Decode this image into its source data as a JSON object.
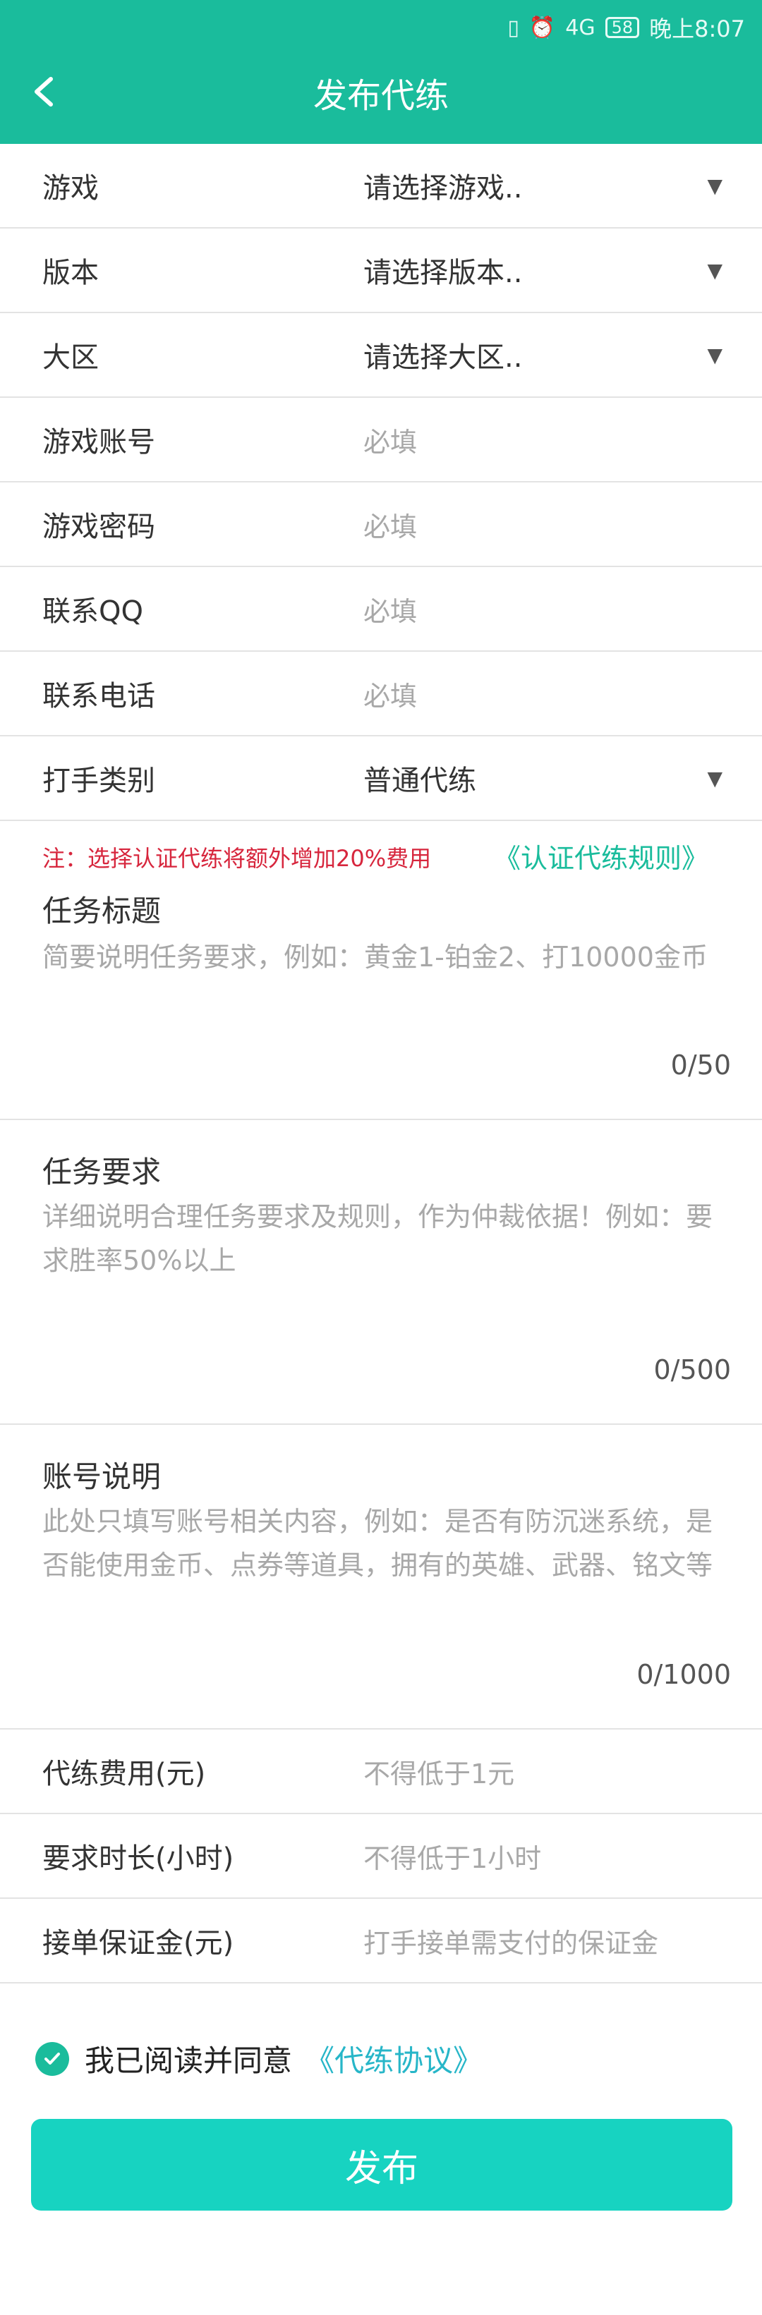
{
  "status_bar": {
    "signal": "4G",
    "battery": "58",
    "time": "晚上8:07"
  },
  "header": {
    "title": "发布代练"
  },
  "fields": [
    {
      "label": "游戏",
      "value": "请选择游戏..",
      "type": "select"
    },
    {
      "label": "版本",
      "value": "请选择版本..",
      "type": "select"
    },
    {
      "label": "大区",
      "value": "请选择大区..",
      "type": "select"
    },
    {
      "label": "游戏账号",
      "placeholder": "必填",
      "type": "input"
    },
    {
      "label": "游戏密码",
      "placeholder": "必填",
      "type": "input"
    },
    {
      "label": "联系QQ",
      "placeholder": "必填",
      "type": "input"
    },
    {
      "label": "联系电话",
      "placeholder": "必填",
      "type": "input"
    },
    {
      "label": "打手类别",
      "value": "普通代练",
      "type": "select"
    }
  ],
  "note": {
    "text": "注：选择认证代练将额外增加20%费用",
    "link": "《认证代练规则》"
  },
  "task_title": {
    "label": "任务标题",
    "placeholder": "简要说明任务要求，例如：黄金1-铂金2、打10000金币",
    "counter": "0/50"
  },
  "task_requirements": {
    "label": "任务要求",
    "placeholder": "详细说明合理任务要求及规则，作为仲裁依据！例如：要求胜率50%以上",
    "counter": "0/500"
  },
  "account_desc": {
    "label": "账号说明",
    "placeholder": "此处只填写账号相关内容，例如：是否有防沉迷系统，是否能使用金币、点券等道具，拥有的英雄、武器、铭文等",
    "counter": "0/1000"
  },
  "fee_fields": [
    {
      "label": "代练费用(元)",
      "placeholder": "不得低于1元"
    },
    {
      "label": "要求时长(小时)",
      "placeholder": "不得低于1小时"
    },
    {
      "label": "接单保证金(元)",
      "placeholder": "打手接单需支付的保证金"
    }
  ],
  "agreement": {
    "text": "我已阅读并同意",
    "link": "《代练协议》",
    "checked": true
  },
  "submit": {
    "label": "发布"
  },
  "colors": {
    "primary": "#1abc9c",
    "button": "#17d3c1",
    "warning": "#d7263d",
    "link": "#27b6c8"
  }
}
